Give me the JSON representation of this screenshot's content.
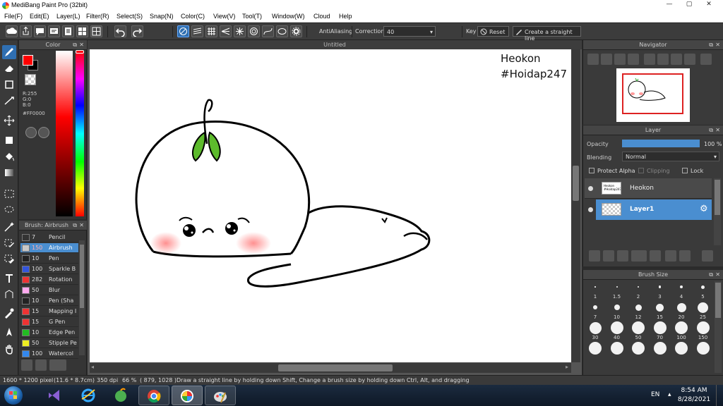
{
  "window": {
    "title": "MediBang Paint Pro (32bit)",
    "controls": {
      "minimize": "—",
      "maximize": "▢",
      "close": "✕"
    }
  },
  "menu": [
    "File(F)",
    "Edit(E)",
    "Layer(L)",
    "Filter(R)",
    "Select(S)",
    "Snap(N)",
    "Color(C)",
    "View(V)",
    "Tool(T)",
    "Window(W)",
    "Cloud",
    "Help"
  ],
  "toolbar": {
    "antialiasing_label": "AntiAliasing",
    "correction_label": "Correction",
    "correction_value": "40",
    "key_label": "Key",
    "reset_label": "Reset",
    "straight_line_label": "Create a straight line"
  },
  "color_panel": {
    "title": "Color",
    "r": "R:255",
    "g": "G:0",
    "b": "B:0",
    "hex": "#FF0000",
    "fg_color": "#ff0000",
    "bg_color": "#000000"
  },
  "brush_panel": {
    "title": "Brush: Airbrush",
    "brushes": [
      {
        "size": "7",
        "name": "Pencil",
        "color": "#333333"
      },
      {
        "size": "150",
        "name": "Airbrush",
        "color": "#c8c8c8"
      },
      {
        "size": "10",
        "name": "Pen",
        "color": "#222222"
      },
      {
        "size": "100",
        "name": "Sparkle B",
        "color": "#3355dd"
      },
      {
        "size": "282",
        "name": "Rotation",
        "color": "#ee3333"
      },
      {
        "size": "50",
        "name": "Blur",
        "color": "#ffaaee"
      },
      {
        "size": "10",
        "name": "Pen (Sha",
        "color": "#222222"
      },
      {
        "size": "15",
        "name": "Mapping I",
        "color": "#ee3333"
      },
      {
        "size": "15",
        "name": "G Pen",
        "color": "#ee3333"
      },
      {
        "size": "10",
        "name": "Edge Pen",
        "color": "#22bb22"
      },
      {
        "size": "50",
        "name": "Stipple Pe",
        "color": "#eeee22"
      },
      {
        "size": "100",
        "name": "Watercol",
        "color": "#3388ee"
      }
    ]
  },
  "canvas": {
    "tab_title": "Untitled",
    "text_line1": "Heokon",
    "text_line2": "#Hoidap247"
  },
  "navigator": {
    "title": "Navigator"
  },
  "layer_panel": {
    "title": "Layer",
    "opacity_label": "Opacity",
    "opacity_value": "100 %",
    "opacity_fraction": 1.0,
    "blending_label": "Blending",
    "blending_value": "Normal",
    "protect_alpha_label": "Protect Alpha",
    "clipping_label": "Clipping",
    "lock_label": "Lock",
    "layers": [
      {
        "name": "Heokon",
        "thumb_text": "Heokon #Hoidap247",
        "selected": false
      },
      {
        "name": "Layer1",
        "selected": true
      }
    ]
  },
  "brush_size_panel": {
    "title": "Brush Size",
    "sizes": [
      "1",
      "1.5",
      "2",
      "3",
      "4",
      "5",
      "7",
      "10",
      "12",
      "15",
      "20",
      "25",
      "30",
      "40",
      "50",
      "70",
      "100",
      "150"
    ]
  },
  "status": {
    "dimensions": "1600 * 1200 pixel",
    "physical": "(11.6 * 8.7cm)",
    "dpi": "350 dpi",
    "zoom": "66 %",
    "coords": "( 879, 1028 )",
    "hint": "Draw a straight line by holding down Shift, Change a brush size by holding down Ctrl, Alt, and dragging"
  },
  "taskbar": {
    "lang": "EN",
    "time": "8:54 AM",
    "date": "8/28/2021"
  }
}
